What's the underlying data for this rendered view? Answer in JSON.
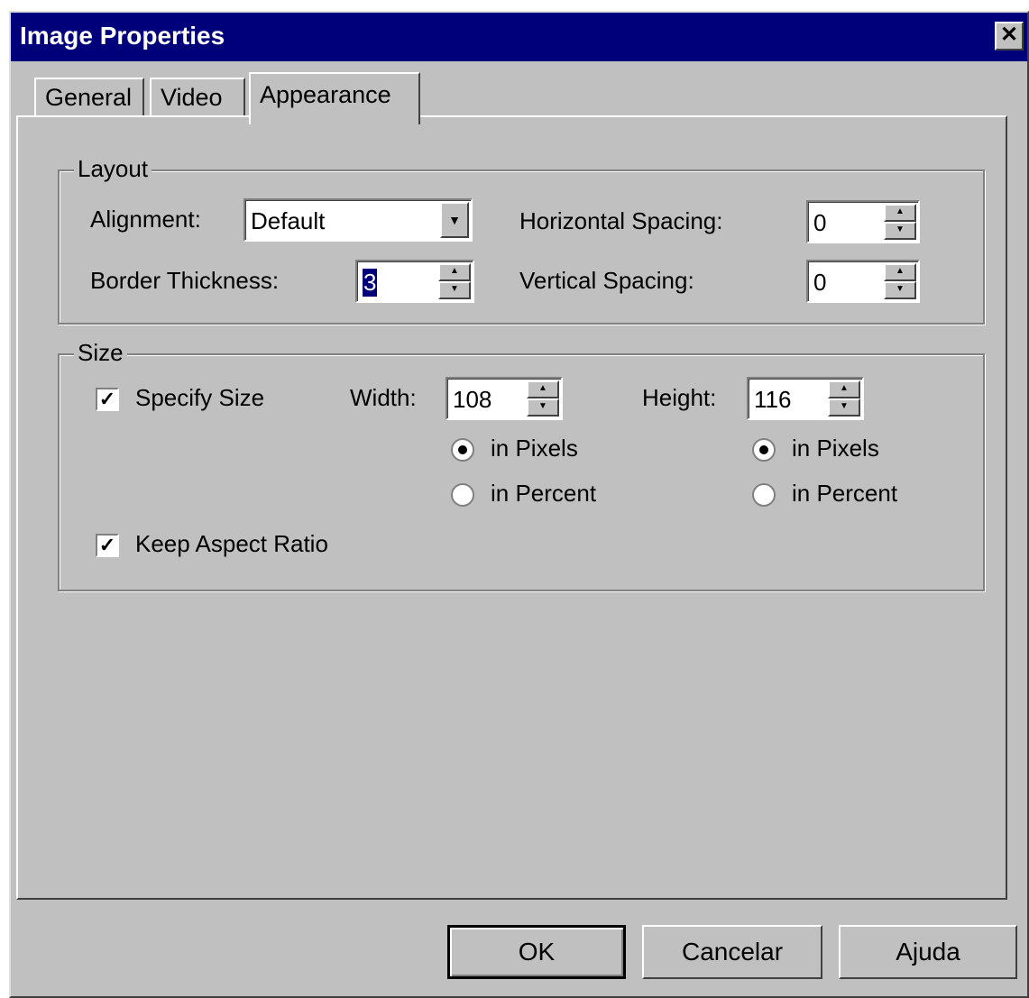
{
  "window": {
    "title": "Image Properties",
    "close_icon": "close-icon"
  },
  "tabs": [
    {
      "label": "General",
      "active": false
    },
    {
      "label": "Video",
      "active": false
    },
    {
      "label": "Appearance",
      "active": true
    }
  ],
  "layout": {
    "legend": "Layout",
    "alignment_label": "Alignment:",
    "alignment_value": "Default",
    "border_label": "Border Thickness:",
    "border_value": "3",
    "hspacing_label": "Horizontal Spacing:",
    "hspacing_value": "0",
    "vspacing_label": "Vertical Spacing:",
    "vspacing_value": "0"
  },
  "size": {
    "legend": "Size",
    "specify_label": "Specify Size",
    "specify_checked": true,
    "width_label": "Width:",
    "width_value": "108",
    "height_label": "Height:",
    "height_value": "116",
    "in_pixels": "in Pixels",
    "in_percent": "in Percent",
    "width_unit": "in Pixels",
    "height_unit": "in Pixels",
    "keep_aspect_label": "Keep Aspect Ratio",
    "keep_aspect_checked": true
  },
  "buttons": {
    "ok": "OK",
    "cancel": "Cancelar",
    "help": "Ajuda"
  }
}
